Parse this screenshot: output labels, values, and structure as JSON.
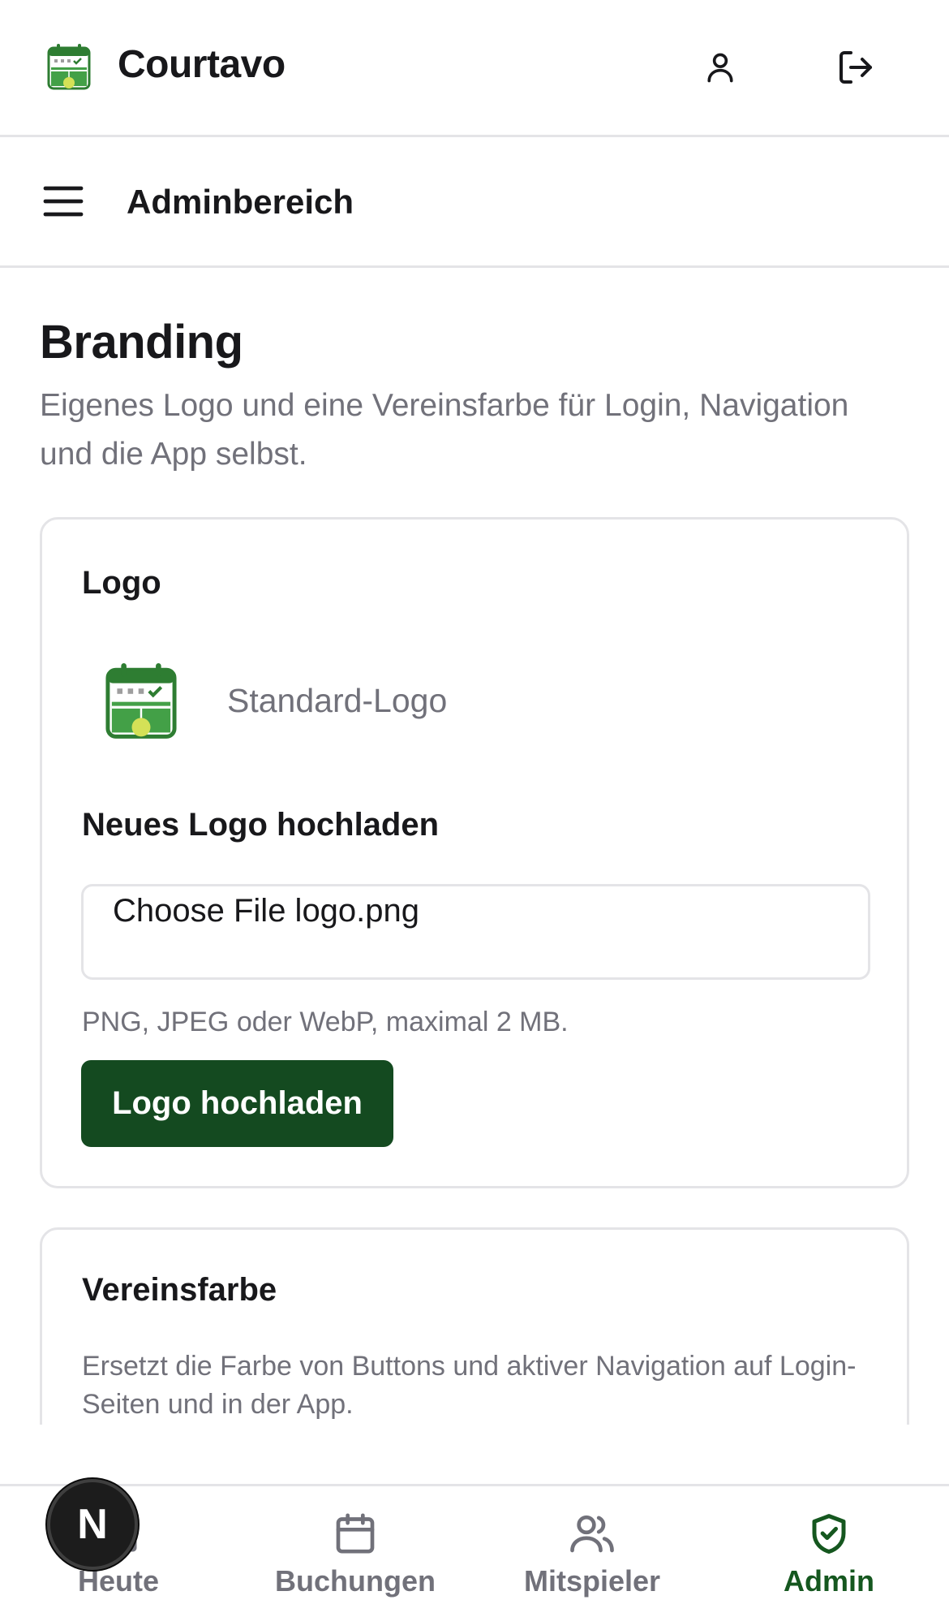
{
  "app": {
    "name": "Courtavo",
    "logo_icon": "court-calendar-logo",
    "brand_color": "#144a20"
  },
  "subheader": {
    "title": "Adminbereich"
  },
  "page": {
    "title": "Branding",
    "description": "Eigenes Logo und eine Vereinsfarbe für Login, Navigation und die App selbst."
  },
  "logo_card": {
    "title": "Logo",
    "preview_label": "Standard-Logo",
    "upload_label": "Neues Logo hochladen",
    "file_input_text": "Choose File logo.png",
    "hint": "PNG, JPEG oder WebP, maximal 2 MB.",
    "upload_button": "Logo hochladen"
  },
  "color_card": {
    "title": "Vereinsfarbe",
    "description": "Ersetzt die Farbe von Buttons und aktiver Navigation auf Login-Seiten und in der App."
  },
  "bottom_nav": {
    "items": [
      {
        "label": "Heute",
        "icon": "home-icon",
        "active": false
      },
      {
        "label": "Buchungen",
        "icon": "calendar-icon",
        "active": false
      },
      {
        "label": "Mitspieler",
        "icon": "users-icon",
        "active": false
      },
      {
        "label": "Admin",
        "icon": "shield-check-icon",
        "active": true
      }
    ],
    "active_color": "#15571f"
  },
  "dev_badge": {
    "letter": "N"
  }
}
